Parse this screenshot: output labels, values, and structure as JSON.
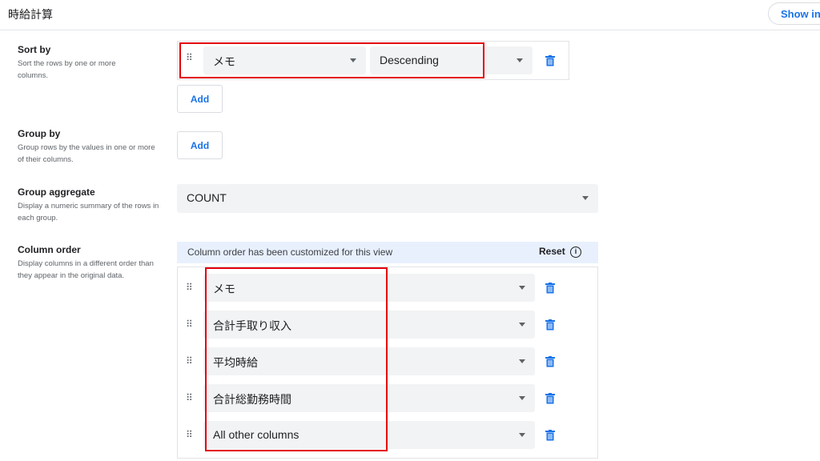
{
  "header": {
    "title": "時給計算",
    "show_in_label": "Show in"
  },
  "sort_by": {
    "heading": "Sort by",
    "description": "Sort the rows by one or more columns.",
    "column_value": "メモ",
    "direction_value": "Descending",
    "add_label": "Add"
  },
  "group_by": {
    "heading": "Group by",
    "description": "Group rows by the values in one or more of their columns.",
    "add_label": "Add"
  },
  "group_aggregate": {
    "heading": "Group aggregate",
    "description": "Display a numeric summary of the rows in each group.",
    "value": "COUNT"
  },
  "column_order": {
    "heading": "Column order",
    "description": "Display columns in a different order than they appear in the original data.",
    "banner_message": "Column order has been customized for this view",
    "reset_label": "Reset",
    "info_glyph": "i",
    "columns": [
      {
        "label": "メモ"
      },
      {
        "label": "合計手取り収入"
      },
      {
        "label": "平均時給"
      },
      {
        "label": "合計総勤務時間"
      },
      {
        "label": "All other columns"
      }
    ]
  },
  "icons": {
    "drag_handle": "drag-handle-icon",
    "delete": "trash-icon",
    "dropdown": "chevron-down-icon",
    "info": "info-icon"
  },
  "colors": {
    "accent": "#1a73e8",
    "highlight": "#e3000b",
    "banner_bg": "#e8f0fe",
    "field_bg": "#f1f3f4"
  }
}
